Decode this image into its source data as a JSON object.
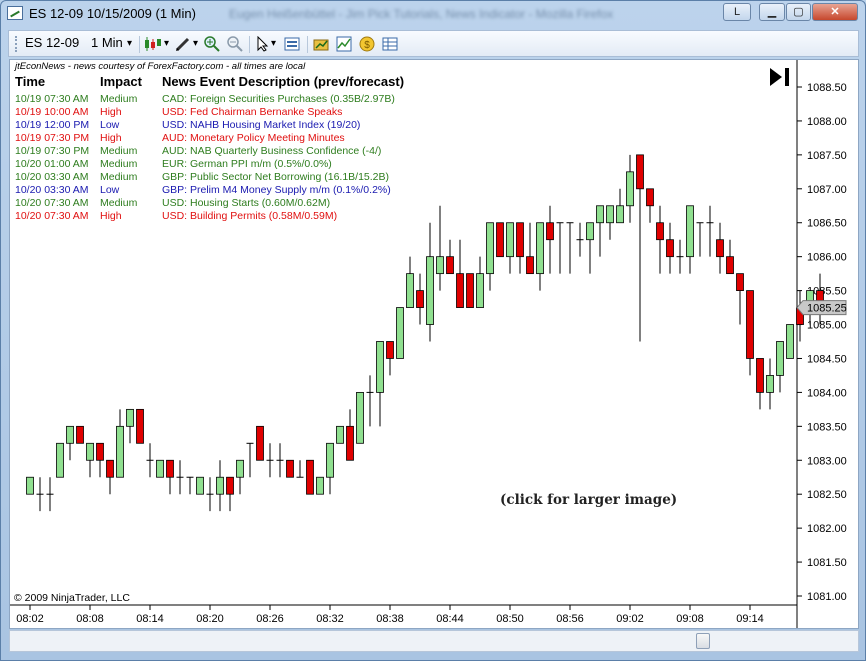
{
  "window": {
    "title": "ES 12-09  10/15/2009 (1 Min)",
    "blurred_title": "Eugen Heißenbüttel - Jim Pick Tutorials, News Indicator - Mozilla Firefox",
    "l_button": "L",
    "min_button": "▁",
    "max_button": "▢",
    "close_button": "✕"
  },
  "toolbar": {
    "instrument": "ES 12-09",
    "interval": "1 Min",
    "dropdown_arrow": "▾",
    "icons": [
      "candlestick-icon",
      "pencil-icon",
      "zoom-in-icon",
      "zoom-out-icon",
      "cursor-icon",
      "properties-icon",
      "strategy-icon",
      "indicator-icon",
      "coin-icon",
      "data-box-icon"
    ]
  },
  "news": {
    "credit": "jtEconNews - news courtesy of ForexFactory.com - all times are local",
    "headers": {
      "time": "Time",
      "impact": "Impact",
      "desc": "News Event Description (prev/forecast)"
    },
    "rows": [
      {
        "time": "10/19 07:30 AM",
        "impact": "Medium",
        "desc": "CAD: Foreign Securities Purchases (0.35B/2.97B)",
        "color": "#2e7d1e"
      },
      {
        "time": "10/19 10:00 AM",
        "impact": "High",
        "desc": "USD: Fed Chairman Bernanke Speaks",
        "color": "#e01010"
      },
      {
        "time": "10/19 12:00 PM",
        "impact": "Low",
        "desc": "USD: NAHB Housing Market Index (19/20)",
        "color": "#1a1ab0"
      },
      {
        "time": "10/19 07:30 PM",
        "impact": "High",
        "desc": "AUD: Monetary Policy Meeting Minutes",
        "color": "#e01010"
      },
      {
        "time": "10/19 07:30 PM",
        "impact": "Medium",
        "desc": "AUD: NAB Quarterly Business Confidence (-4/)",
        "color": "#2e7d1e"
      },
      {
        "time": "10/20 01:00 AM",
        "impact": "Medium",
        "desc": "EUR: German PPI m/m (0.5%/0.0%)",
        "color": "#2e7d1e"
      },
      {
        "time": "10/20 03:30 AM",
        "impact": "Medium",
        "desc": "GBP: Public Sector Net Borrowing (16.1B/15.2B)",
        "color": "#2e7d1e"
      },
      {
        "time": "10/20 03:30 AM",
        "impact": "Low",
        "desc": "GBP: Prelim M4 Money Supply m/m (0.1%/0.2%)",
        "color": "#1a1ab0"
      },
      {
        "time": "10/20 07:30 AM",
        "impact": "Medium",
        "desc": "USD: Housing Starts (0.60M/0.62M)",
        "color": "#2e7d1e"
      },
      {
        "time": "10/20 07:30 AM",
        "impact": "High",
        "desc": "USD: Building Permits (0.58M/0.59M)",
        "color": "#e01010"
      }
    ]
  },
  "click_note": "(click for larger image)",
  "copyright": "© 2009 NinjaTrader, LLC",
  "price_badge": "1085.25",
  "chart_data": {
    "type": "candlestick",
    "x_ticks": [
      "08:02",
      "08:08",
      "08:14",
      "08:20",
      "08:26",
      "08:32",
      "08:38",
      "08:44",
      "08:50",
      "08:56",
      "09:02",
      "09:08",
      "09:14"
    ],
    "y_ticks": [
      "1088.50",
      "1088.00",
      "1087.50",
      "1087.00",
      "1086.50",
      "1086.00",
      "1085.50",
      "1085.00",
      "1084.50",
      "1084.00",
      "1083.50",
      "1083.00",
      "1082.50",
      "1082.00",
      "1081.50",
      "1081.00"
    ],
    "ylim": [
      1080.8,
      1088.75
    ],
    "up_color": "#90e090",
    "down_color": "#e00000",
    "candles": [
      {
        "o": 1082.5,
        "h": 1082.75,
        "l": 1082.5,
        "c": 1082.75
      },
      {
        "o": 1082.5,
        "h": 1082.75,
        "l": 1082.25,
        "c": 1082.5
      },
      {
        "o": 1082.5,
        "h": 1082.75,
        "l": 1082.25,
        "c": 1082.5
      },
      {
        "o": 1082.75,
        "h": 1083.25,
        "l": 1082.75,
        "c": 1083.25
      },
      {
        "o": 1083.25,
        "h": 1083.5,
        "l": 1083.0,
        "c": 1083.5
      },
      {
        "o": 1083.5,
        "h": 1083.5,
        "l": 1083.25,
        "c": 1083.25
      },
      {
        "o": 1083.0,
        "h": 1083.25,
        "l": 1082.75,
        "c": 1083.25
      },
      {
        "o": 1083.25,
        "h": 1083.25,
        "l": 1082.75,
        "c": 1083.0
      },
      {
        "o": 1083.0,
        "h": 1083.0,
        "l": 1082.5,
        "c": 1082.75
      },
      {
        "o": 1082.75,
        "h": 1083.75,
        "l": 1082.75,
        "c": 1083.5
      },
      {
        "o": 1083.5,
        "h": 1083.75,
        "l": 1083.25,
        "c": 1083.75
      },
      {
        "o": 1083.75,
        "h": 1083.75,
        "l": 1083.25,
        "c": 1083.25
      },
      {
        "o": 1083.0,
        "h": 1083.25,
        "l": 1082.75,
        "c": 1083.0
      },
      {
        "o": 1082.75,
        "h": 1083.0,
        "l": 1082.75,
        "c": 1083.0
      },
      {
        "o": 1083.0,
        "h": 1083.0,
        "l": 1082.5,
        "c": 1082.75
      },
      {
        "o": 1082.75,
        "h": 1083.0,
        "l": 1082.5,
        "c": 1082.75
      },
      {
        "o": 1082.75,
        "h": 1082.75,
        "l": 1082.5,
        "c": 1082.75
      },
      {
        "o": 1082.5,
        "h": 1082.75,
        "l": 1082.5,
        "c": 1082.75
      },
      {
        "o": 1082.5,
        "h": 1082.75,
        "l": 1082.25,
        "c": 1082.5
      },
      {
        "o": 1082.5,
        "h": 1083.0,
        "l": 1082.25,
        "c": 1082.75
      },
      {
        "o": 1082.75,
        "h": 1082.75,
        "l": 1082.25,
        "c": 1082.5
      },
      {
        "o": 1082.75,
        "h": 1083.0,
        "l": 1082.5,
        "c": 1083.0
      },
      {
        "o": 1083.25,
        "h": 1083.25,
        "l": 1082.75,
        "c": 1083.25
      },
      {
        "o": 1083.5,
        "h": 1083.5,
        "l": 1083.0,
        "c": 1083.0
      },
      {
        "o": 1083.0,
        "h": 1083.25,
        "l": 1082.75,
        "c": 1083.0
      },
      {
        "o": 1083.0,
        "h": 1083.25,
        "l": 1082.75,
        "c": 1083.0
      },
      {
        "o": 1083.0,
        "h": 1083.0,
        "l": 1082.75,
        "c": 1082.75
      },
      {
        "o": 1082.75,
        "h": 1083.0,
        "l": 1082.75,
        "c": 1082.75
      },
      {
        "o": 1083.0,
        "h": 1083.0,
        "l": 1082.5,
        "c": 1082.5
      },
      {
        "o": 1082.5,
        "h": 1082.75,
        "l": 1082.5,
        "c": 1082.75
      },
      {
        "o": 1082.75,
        "h": 1083.25,
        "l": 1082.5,
        "c": 1083.25
      },
      {
        "o": 1083.25,
        "h": 1083.5,
        "l": 1083.25,
        "c": 1083.5
      },
      {
        "o": 1083.5,
        "h": 1083.75,
        "l": 1083.0,
        "c": 1083.0
      },
      {
        "o": 1083.25,
        "h": 1084.0,
        "l": 1083.25,
        "c": 1084.0
      },
      {
        "o": 1084.0,
        "h": 1084.25,
        "l": 1083.5,
        "c": 1084.0
      },
      {
        "o": 1084.0,
        "h": 1084.75,
        "l": 1083.5,
        "c": 1084.75
      },
      {
        "o": 1084.75,
        "h": 1084.75,
        "l": 1084.25,
        "c": 1084.5
      },
      {
        "o": 1084.5,
        "h": 1085.25,
        "l": 1084.5,
        "c": 1085.25
      },
      {
        "o": 1085.25,
        "h": 1086.0,
        "l": 1085.25,
        "c": 1085.75
      },
      {
        "o": 1085.5,
        "h": 1085.75,
        "l": 1085.0,
        "c": 1085.25
      },
      {
        "o": 1085.0,
        "h": 1086.5,
        "l": 1084.75,
        "c": 1086.0
      },
      {
        "o": 1085.75,
        "h": 1086.75,
        "l": 1085.5,
        "c": 1086.0
      },
      {
        "o": 1086.0,
        "h": 1086.25,
        "l": 1085.75,
        "c": 1085.75
      },
      {
        "o": 1085.75,
        "h": 1086.25,
        "l": 1085.25,
        "c": 1085.25
      },
      {
        "o": 1085.75,
        "h": 1085.75,
        "l": 1085.25,
        "c": 1085.25
      },
      {
        "o": 1085.25,
        "h": 1086.0,
        "l": 1085.25,
        "c": 1085.75
      },
      {
        "o": 1085.75,
        "h": 1086.5,
        "l": 1085.5,
        "c": 1086.5
      },
      {
        "o": 1086.5,
        "h": 1086.5,
        "l": 1086.0,
        "c": 1086.0
      },
      {
        "o": 1086.0,
        "h": 1086.5,
        "l": 1085.75,
        "c": 1086.5
      },
      {
        "o": 1086.5,
        "h": 1086.5,
        "l": 1085.75,
        "c": 1086.0
      },
      {
        "o": 1086.0,
        "h": 1086.5,
        "l": 1085.75,
        "c": 1085.75
      },
      {
        "o": 1085.75,
        "h": 1086.5,
        "l": 1085.5,
        "c": 1086.5
      },
      {
        "o": 1086.5,
        "h": 1086.75,
        "l": 1085.75,
        "c": 1086.25
      },
      {
        "o": 1086.5,
        "h": 1086.5,
        "l": 1085.75,
        "c": 1086.5
      },
      {
        "o": 1086.5,
        "h": 1086.5,
        "l": 1085.75,
        "c": 1086.5
      },
      {
        "o": 1086.25,
        "h": 1086.5,
        "l": 1086.0,
        "c": 1086.25
      },
      {
        "o": 1086.25,
        "h": 1086.5,
        "l": 1085.75,
        "c": 1086.5
      },
      {
        "o": 1086.5,
        "h": 1086.75,
        "l": 1086.0,
        "c": 1086.75
      },
      {
        "o": 1086.5,
        "h": 1086.75,
        "l": 1086.25,
        "c": 1086.75
      },
      {
        "o": 1086.5,
        "h": 1087.0,
        "l": 1086.5,
        "c": 1086.75
      },
      {
        "o": 1086.75,
        "h": 1087.5,
        "l": 1086.5,
        "c": 1087.25
      },
      {
        "o": 1087.5,
        "h": 1087.5,
        "l": 1084.75,
        "c": 1087.0
      },
      {
        "o": 1087.0,
        "h": 1087.0,
        "l": 1086.5,
        "c": 1086.75
      },
      {
        "o": 1086.5,
        "h": 1086.75,
        "l": 1085.75,
        "c": 1086.25
      },
      {
        "o": 1086.25,
        "h": 1086.5,
        "l": 1085.75,
        "c": 1086.0
      },
      {
        "o": 1086.0,
        "h": 1086.25,
        "l": 1085.75,
        "c": 1086.0
      },
      {
        "o": 1086.0,
        "h": 1086.75,
        "l": 1085.75,
        "c": 1086.75
      },
      {
        "o": 1086.5,
        "h": 1086.5,
        "l": 1086.0,
        "c": 1086.5
      },
      {
        "o": 1086.5,
        "h": 1086.75,
        "l": 1086.0,
        "c": 1086.5
      },
      {
        "o": 1086.25,
        "h": 1086.5,
        "l": 1085.75,
        "c": 1086.0
      },
      {
        "o": 1086.0,
        "h": 1086.25,
        "l": 1085.75,
        "c": 1085.75
      },
      {
        "o": 1085.75,
        "h": 1085.75,
        "l": 1085.0,
        "c": 1085.5
      },
      {
        "o": 1085.5,
        "h": 1085.5,
        "l": 1084.25,
        "c": 1084.5
      },
      {
        "o": 1084.5,
        "h": 1084.5,
        "l": 1083.75,
        "c": 1084.0
      },
      {
        "o": 1084.0,
        "h": 1084.5,
        "l": 1083.75,
        "c": 1084.25
      },
      {
        "o": 1084.25,
        "h": 1084.75,
        "l": 1084.0,
        "c": 1084.75
      },
      {
        "o": 1084.5,
        "h": 1085.0,
        "l": 1084.5,
        "c": 1085.0
      },
      {
        "o": 1085.25,
        "h": 1085.5,
        "l": 1084.75,
        "c": 1085.0
      },
      {
        "o": 1085.25,
        "h": 1085.5,
        "l": 1085.0,
        "c": 1085.5
      },
      {
        "o": 1085.5,
        "h": 1085.75,
        "l": 1085.0,
        "c": 1085.25
      }
    ]
  }
}
